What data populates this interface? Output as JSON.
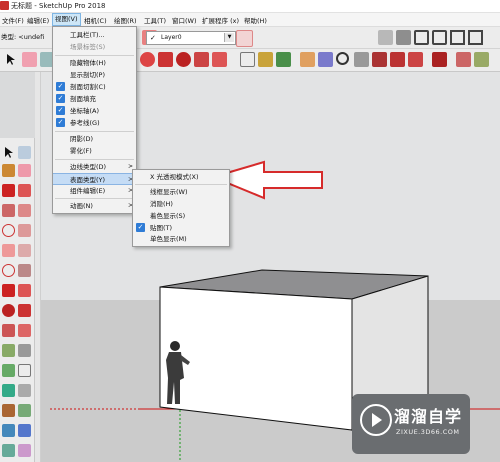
{
  "window": {
    "title": "无标题 - SketchUp Pro 2018"
  },
  "menubar": {
    "items": [
      "文件(F)",
      "编辑(E)",
      "视图(V)",
      "相机(C)",
      "绘图(R)",
      "工具(T)",
      "窗口(W)",
      "扩展程序 (x)",
      "帮助(H)"
    ],
    "active_index": 2
  },
  "layer_toolbar": {
    "label": "类型: <undefi",
    "layer_value": "Layer0"
  },
  "view_menu": {
    "items": [
      {
        "label": "工具栏(T)...",
        "checked": false,
        "disabled": false,
        "submenu": false
      },
      {
        "label": "场景标签(S)",
        "checked": false,
        "disabled": true,
        "submenu": false
      },
      {
        "label": "隐藏物体(H)",
        "checked": false,
        "disabled": false,
        "submenu": false
      },
      {
        "label": "显示剖切(P)",
        "checked": false,
        "disabled": false,
        "submenu": false
      },
      {
        "label": "剖面切割(C)",
        "checked": true,
        "disabled": false,
        "submenu": false
      },
      {
        "label": "剖面填充",
        "checked": true,
        "disabled": false,
        "submenu": false
      },
      {
        "label": "坐标轴(A)",
        "checked": true,
        "disabled": false,
        "submenu": false
      },
      {
        "label": "参考线(G)",
        "checked": true,
        "disabled": false,
        "submenu": false
      },
      {
        "label": "阴影(D)",
        "checked": false,
        "disabled": false,
        "submenu": false
      },
      {
        "label": "雾化(F)",
        "checked": false,
        "disabled": false,
        "submenu": false
      },
      {
        "label": "边线类型(D)",
        "checked": false,
        "disabled": false,
        "submenu": true
      },
      {
        "label": "表面类型(Y)",
        "checked": false,
        "disabled": false,
        "submenu": true,
        "highlighted": true
      },
      {
        "label": "组件编辑(E)",
        "checked": false,
        "disabled": false,
        "submenu": true
      },
      {
        "label": "动画(N)",
        "checked": false,
        "disabled": false,
        "submenu": true
      }
    ]
  },
  "face_style_submenu": {
    "items": [
      {
        "label": "X 光透视模式(X)",
        "checked": false
      },
      {
        "label": "线框显示(W)",
        "checked": false
      },
      {
        "label": "消隐(H)",
        "checked": false
      },
      {
        "label": "着色显示(S)",
        "checked": false
      },
      {
        "label": "贴图(T)",
        "checked": true
      },
      {
        "label": "单色显示(M)",
        "checked": false
      }
    ]
  },
  "watermark": {
    "title": "溜溜自学",
    "url": "ZIXUE.3D66.COM"
  },
  "colors": {
    "menu_highlight": "#c5dcf5",
    "check_blue": "#2f7cd6",
    "arrow_red": "#d62b2b",
    "axis_red": "#d01010",
    "axis_green": "#1a9a1a"
  }
}
